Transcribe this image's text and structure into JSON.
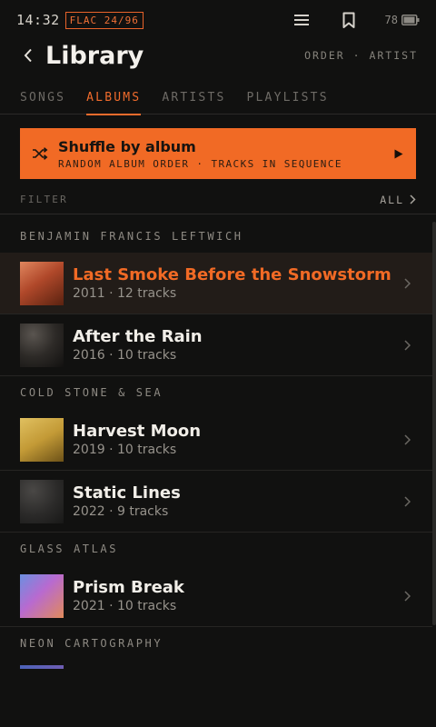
{
  "status": {
    "time": "14:32",
    "format_badge": "FLAC 24/96",
    "battery": "78",
    "icons": [
      "menu-icon",
      "bookmark-icon",
      "battery-icon"
    ]
  },
  "header": {
    "title": "Library",
    "order": "ORDER · ARTIST"
  },
  "tabs": [
    {
      "label": "SONGS",
      "active": false
    },
    {
      "label": "ALBUMS",
      "active": true
    },
    {
      "label": "ARTISTS",
      "active": false
    },
    {
      "label": "PLAYLISTS",
      "active": false
    }
  ],
  "shuffle": {
    "title": "Shuffle by album",
    "subtitle": "RANDOM ALBUM ORDER · TRACKS IN SEQUENCE",
    "accent": "#f16a25"
  },
  "filter": {
    "label": "FILTER",
    "value": "ALL"
  },
  "groups": [
    {
      "artist": "BENJAMIN FRANCIS LEFTWICH",
      "albums": [
        {
          "title": "Last Smoke Before the Snowstorm",
          "meta": "2011 · 12 tracks",
          "selected": true
        },
        {
          "title": "After the Rain",
          "meta": "2016 · 10 tracks",
          "selected": false
        }
      ]
    },
    {
      "artist": "COLD STONE & SEA",
      "albums": [
        {
          "title": "Harvest Moon",
          "meta": "2019 · 10 tracks",
          "selected": false
        },
        {
          "title": "Static Lines",
          "meta": "2022 · 9 tracks",
          "selected": false
        }
      ]
    },
    {
      "artist": "GLASS ATLAS",
      "albums": [
        {
          "title": "Prism Break",
          "meta": "2021 · 10 tracks",
          "selected": false
        }
      ]
    },
    {
      "artist": "NEON CARTOGRAPHY",
      "albums": []
    }
  ]
}
